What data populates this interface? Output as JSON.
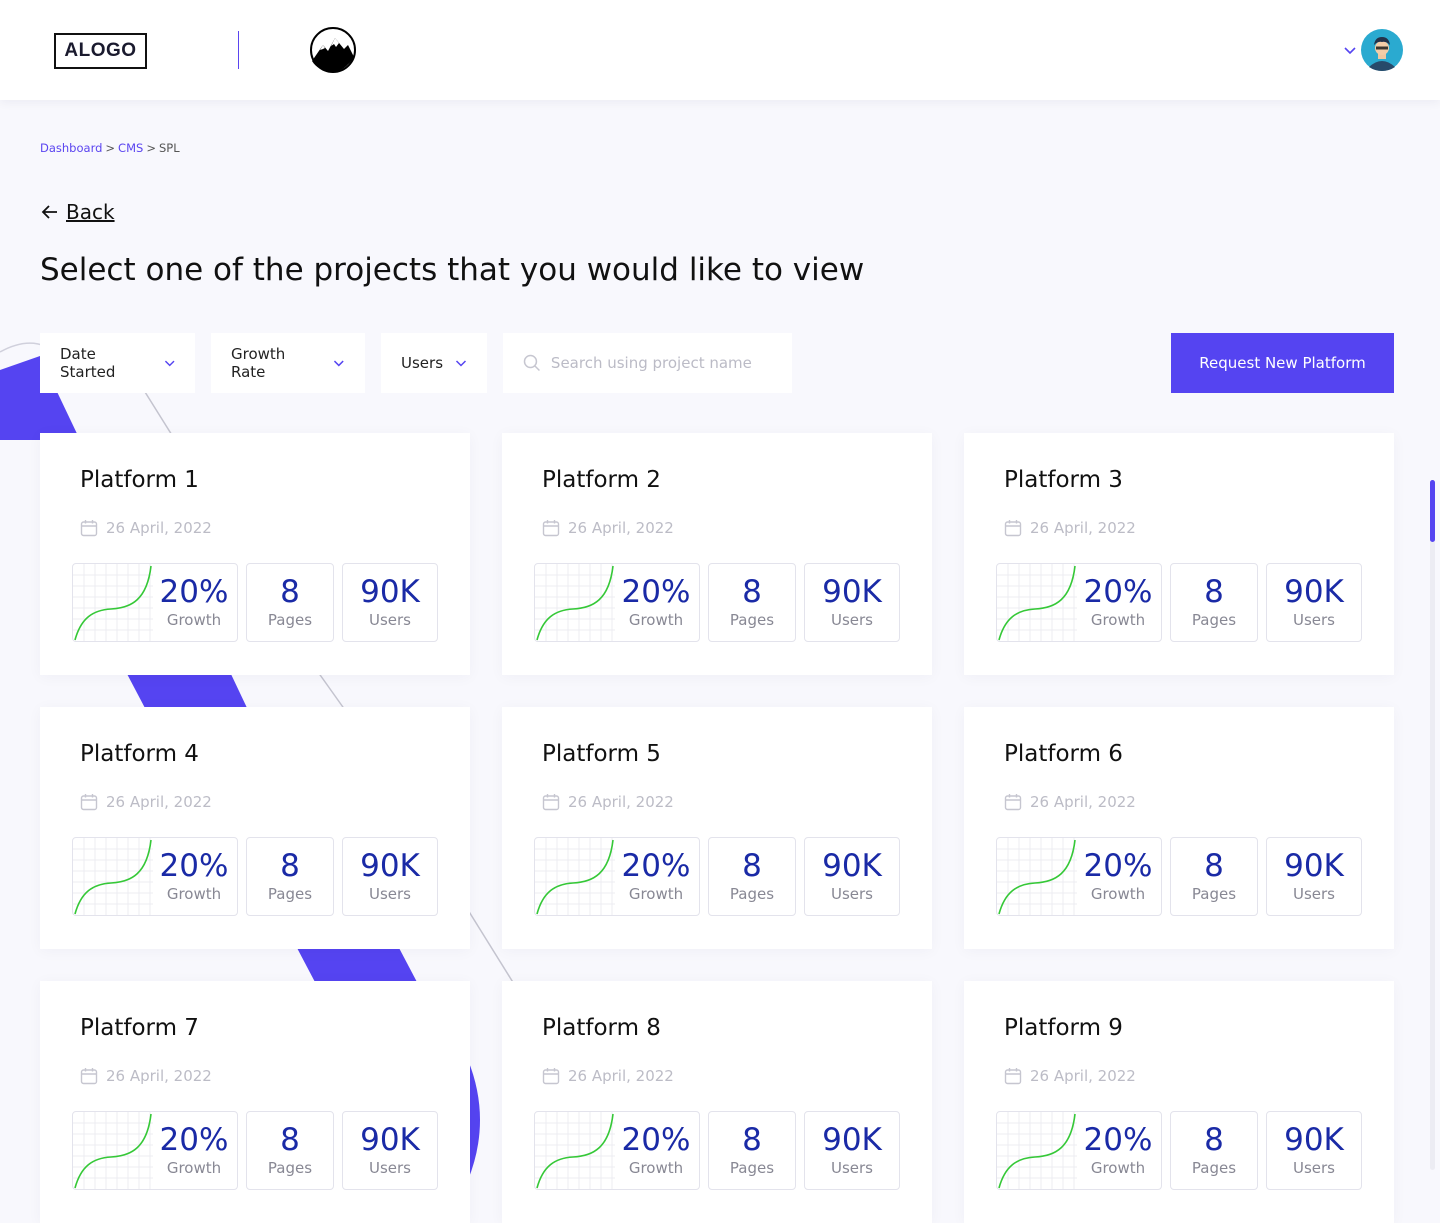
{
  "header": {
    "logo_text": "ALOGO",
    "logo_icon": "mountain-icon",
    "user_menu_icon": "chevron-down-icon",
    "avatar_icon": "avatar-icon"
  },
  "breadcrumb": {
    "items": [
      "Dashboard",
      "CMS",
      "SPL"
    ],
    "separator": ">"
  },
  "back": {
    "label": "Back",
    "icon": "arrow-left-icon"
  },
  "page_title": "Select one of the projects that you would like to view",
  "filters": {
    "date_started": "Date Started",
    "growth_rate": "Growth Rate",
    "users": "Users",
    "chevron_icon": "chevron-down-icon"
  },
  "search": {
    "placeholder": "Search using project name",
    "value": "",
    "icon": "search-icon"
  },
  "actions": {
    "request_label": "Request New Platform"
  },
  "colors": {
    "accent": "#5544f1",
    "stat_value": "#1a2aa6",
    "growth_line": "#35c837",
    "page_bg": "#f8f8fd"
  },
  "platforms": [
    {
      "name": "Platform 1",
      "date": "26 April, 2022",
      "growth": "20%",
      "growth_label": "Growth",
      "pages": "8",
      "pages_label": "Pages",
      "users": "90K",
      "users_label": "Users"
    },
    {
      "name": "Platform 2",
      "date": "26 April, 2022",
      "growth": "20%",
      "growth_label": "Growth",
      "pages": "8",
      "pages_label": "Pages",
      "users": "90K",
      "users_label": "Users"
    },
    {
      "name": "Platform 3",
      "date": "26 April, 2022",
      "growth": "20%",
      "growth_label": "Growth",
      "pages": "8",
      "pages_label": "Pages",
      "users": "90K",
      "users_label": "Users"
    },
    {
      "name": "Platform 4",
      "date": "26 April, 2022",
      "growth": "20%",
      "growth_label": "Growth",
      "pages": "8",
      "pages_label": "Pages",
      "users": "90K",
      "users_label": "Users"
    },
    {
      "name": "Platform 5",
      "date": "26 April, 2022",
      "growth": "20%",
      "growth_label": "Growth",
      "pages": "8",
      "pages_label": "Pages",
      "users": "90K",
      "users_label": "Users"
    },
    {
      "name": "Platform 6",
      "date": "26 April, 2022",
      "growth": "20%",
      "growth_label": "Growth",
      "pages": "8",
      "pages_label": "Pages",
      "users": "90K",
      "users_label": "Users"
    },
    {
      "name": "Platform 7",
      "date": "26 April, 2022",
      "growth": "20%",
      "growth_label": "Growth",
      "pages": "8",
      "pages_label": "Pages",
      "users": "90K",
      "users_label": "Users"
    },
    {
      "name": "Platform 8",
      "date": "26 April, 2022",
      "growth": "20%",
      "growth_label": "Growth",
      "pages": "8",
      "pages_label": "Pages",
      "users": "90K",
      "users_label": "Users"
    },
    {
      "name": "Platform 9",
      "date": "26 April, 2022",
      "growth": "20%",
      "growth_label": "Growth",
      "pages": "8",
      "pages_label": "Pages",
      "users": "90K",
      "users_label": "Users"
    }
  ]
}
